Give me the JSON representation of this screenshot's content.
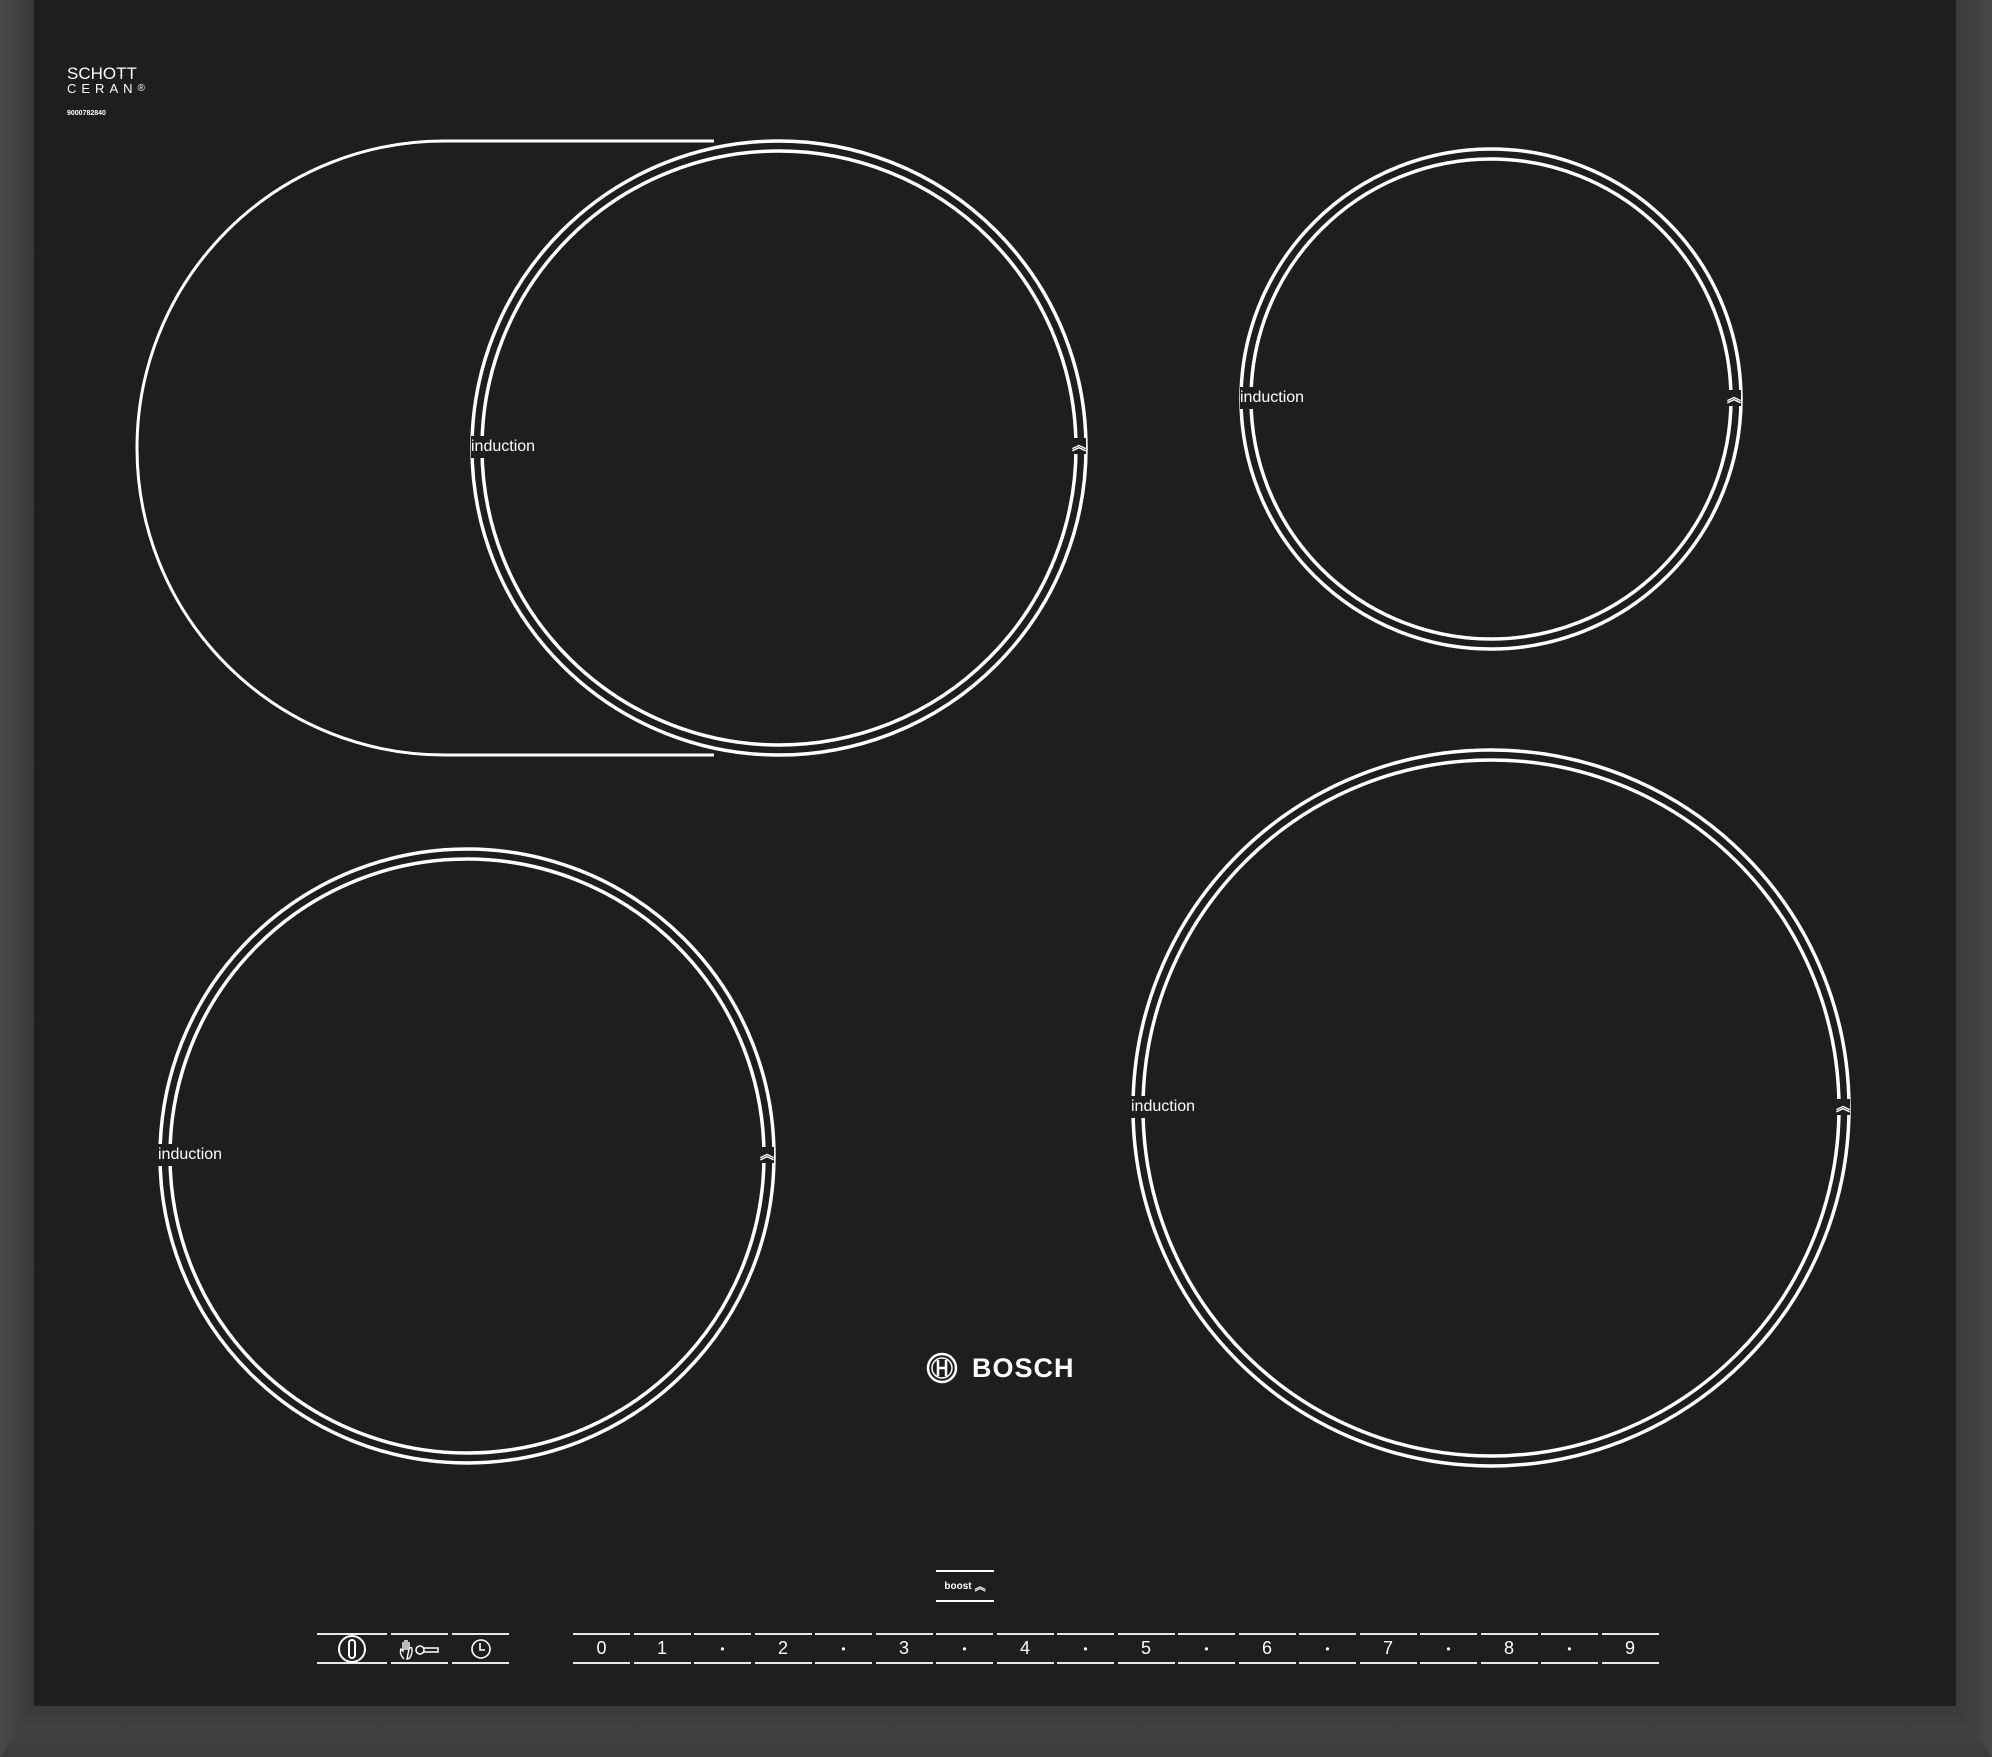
{
  "panel": {
    "glass_brand_line1": "SCHOTT",
    "glass_brand_line2": "CERAN",
    "registered_mark": "®",
    "serial_number": "9000782840",
    "brand": "BOSCH",
    "colors": {
      "glass": "#1f1e1c",
      "frame": "#3b3b3b",
      "markings": "#ffffff"
    }
  },
  "zones": [
    {
      "id": "front-left-flex",
      "label": "induction",
      "boost_icon": "double-chevron-up",
      "extendable": true
    },
    {
      "id": "rear-right",
      "label": "induction",
      "boost_icon": "double-chevron-up"
    },
    {
      "id": "front-left",
      "label": "induction",
      "boost_icon": "double-chevron-up"
    },
    {
      "id": "front-right",
      "label": "induction",
      "boost_icon": "double-chevron-up"
    }
  ],
  "controls": {
    "boost_label": "boost",
    "boost_icon": "double-chevron-up",
    "main_switch_icon": "power-icon",
    "child_lock_icon": "hand-key-icon",
    "timer_icon": "clock-icon",
    "power_levels": [
      "0",
      "1",
      "•",
      "2",
      "•",
      "3",
      "•",
      "4",
      "•",
      "5",
      "•",
      "6",
      "•",
      "7",
      "•",
      "8",
      "•",
      "9"
    ]
  }
}
